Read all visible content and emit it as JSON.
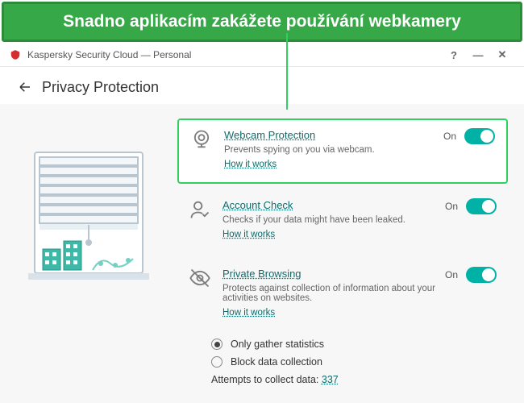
{
  "banner": {
    "text": "Snadno aplikacím zakážete používání webkamery"
  },
  "titlebar": {
    "app_name": "Kaspersky Security Cloud — Personal"
  },
  "header": {
    "page_title": "Privacy Protection"
  },
  "features": [
    {
      "id": "webcam",
      "icon": "webcam-icon",
      "title": "Webcam Protection",
      "desc": "Prevents spying on you via webcam.",
      "how": "How it works",
      "state_label": "On",
      "highlight": true
    },
    {
      "id": "account",
      "icon": "account-check-icon",
      "title": "Account Check",
      "desc": "Checks if your data might have been leaked.",
      "how": "How it works",
      "state_label": "On",
      "highlight": false
    },
    {
      "id": "private",
      "icon": "eye-off-icon",
      "title": "Private Browsing",
      "desc": "Protects against collection of information about your activities on websites.",
      "how": "How it works",
      "state_label": "On",
      "highlight": false
    }
  ],
  "private_options": {
    "radios": [
      {
        "label": "Only gather statistics",
        "selected": true
      },
      {
        "label": "Block data collection",
        "selected": false
      }
    ],
    "attempts_label": "Attempts to collect data:",
    "attempts_count": "337"
  },
  "colors": {
    "accent": "#00b1a6",
    "highlight": "#2fd060",
    "link": "#0f6b6b",
    "banner_bg": "#37a848"
  }
}
